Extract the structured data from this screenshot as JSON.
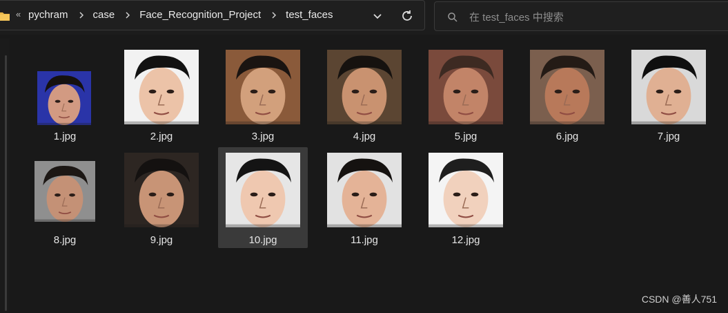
{
  "address_bar": {
    "breadcrumb": [
      "pychram",
      "case",
      "Face_Recognition_Project",
      "test_faces"
    ],
    "overflow_glyph": "«"
  },
  "search": {
    "placeholder": "在 test_faces 中搜索",
    "value": ""
  },
  "files": [
    {
      "name": "1.jpg",
      "selected": false,
      "bg": "#2a34a8",
      "skin": "#d29a82",
      "hair": "#15110f"
    },
    {
      "name": "2.jpg",
      "selected": false,
      "bg": "#f2f2f2",
      "skin": "#ecc3a8",
      "hair": "#121212"
    },
    {
      "name": "3.jpg",
      "selected": false,
      "bg": "#8a5a3a",
      "skin": "#d2a07c",
      "hair": "#1a1411"
    },
    {
      "name": "4.jpg",
      "selected": false,
      "bg": "#5b4532",
      "skin": "#c99270",
      "hair": "#16120f"
    },
    {
      "name": "5.jpg",
      "selected": false,
      "bg": "#7a4a3c",
      "skin": "#c28468",
      "hair": "#3d2a22"
    },
    {
      "name": "6.jpg",
      "selected": false,
      "bg": "#7b5f4e",
      "skin": "#b8795a",
      "hair": "#241b16"
    },
    {
      "name": "7.jpg",
      "selected": false,
      "bg": "#d9d9d9",
      "skin": "#e0b093",
      "hair": "#0f0f0f"
    },
    {
      "name": "8.jpg",
      "selected": false,
      "bg": "#8f8f8f",
      "skin": "#c49176",
      "hair": "#1c1714"
    },
    {
      "name": "9.jpg",
      "selected": false,
      "bg": "#2d2622",
      "skin": "#c89476",
      "hair": "#141110"
    },
    {
      "name": "10.jpg",
      "selected": true,
      "bg": "#e6e6e6",
      "skin": "#efc8b0",
      "hair": "#141414"
    },
    {
      "name": "11.jpg",
      "selected": false,
      "bg": "#e2e2e2",
      "skin": "#e4b397",
      "hair": "#151210"
    },
    {
      "name": "12.jpg",
      "selected": false,
      "bg": "#f4f4f4",
      "skin": "#f1d1bd",
      "hair": "#1e1e1e"
    }
  ],
  "watermark": "CSDN @善人751",
  "colors": {
    "background": "#191919",
    "selected_tile": "#3a3a3a",
    "text": "#e6e6e6"
  },
  "icons": [
    "folder-icon",
    "chevron-right-icon",
    "chevron-down-icon",
    "refresh-icon",
    "search-icon"
  ]
}
